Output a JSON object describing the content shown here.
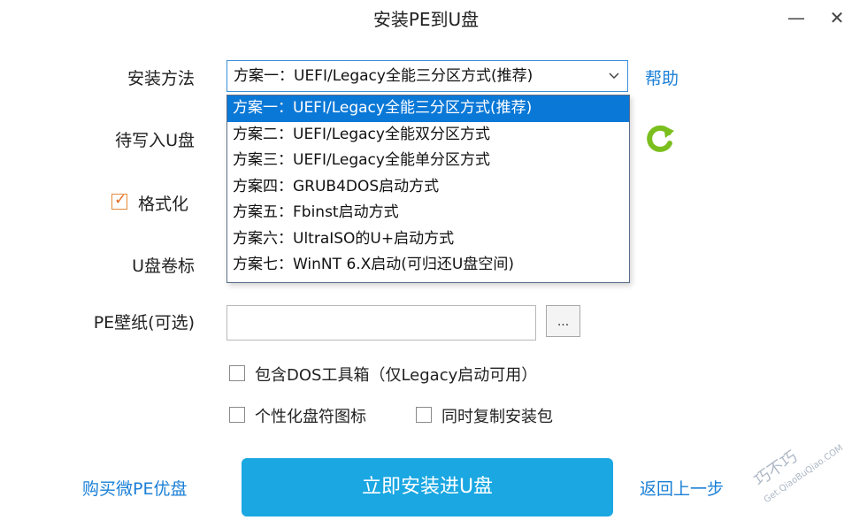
{
  "window": {
    "title": "安装PE到U盘",
    "minimize_glyph": "—",
    "close_glyph": "✕"
  },
  "form": {
    "method_label": "安装方法",
    "method_selected": "方案一：UEFI/Legacy全能三分区方式(推荐)",
    "help_link": "帮助",
    "dropdown_options": [
      "方案一：UEFI/Legacy全能三分区方式(推荐)",
      "方案二：UEFI/Legacy全能双分区方式",
      "方案三：UEFI/Legacy全能单分区方式",
      "方案四：GRUB4DOS启动方式",
      "方案五：Fbinst启动方式",
      "方案六：UltraISO的U+启动方式",
      "方案七：WinNT 6.X启动(可归还U盘空间)"
    ],
    "target_label": "待写入U盘",
    "format_label": "格式化",
    "format_checked": true,
    "volume_label": "U盘卷标",
    "wallpaper_label": "PE壁纸(可选)",
    "wallpaper_value": "",
    "browse_label": "...",
    "dos_toolbox_label": "包含DOS工具箱（仅Legacy启动可用）",
    "custom_icon_label": "个性化盘符图标",
    "copy_package_label": "同时复制安装包",
    "refresh_icon": "refresh-icon"
  },
  "footer": {
    "buy_link": "购买微PE优盘",
    "install_button": "立即安装进U盘",
    "back_link": "返回上一步"
  },
  "watermark": {
    "line1": "巧不巧",
    "line2": "Get.QiaoBuQiao.COM"
  },
  "colors": {
    "accent": "#1aa7e2",
    "link": "#1a7fd6",
    "selected": "#0a78d7",
    "refresh": "#7bbf1e",
    "check": "#e26a1c"
  }
}
